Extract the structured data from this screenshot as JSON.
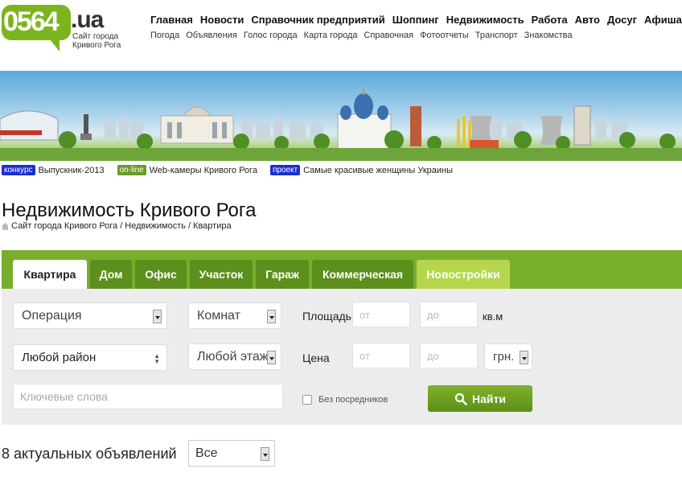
{
  "logo": {
    "number": "0564",
    "domain": ".ua",
    "tagline": "Сайт города Кривого Рога"
  },
  "topnav": [
    "Главная",
    "Новости",
    "Справочник предприятий",
    "Шоппинг",
    "Недвижимость",
    "Работа",
    "Авто",
    "Досуг",
    "Афиша"
  ],
  "subnav": [
    "Погода",
    "Объявления",
    "Голос города",
    "Карта города",
    "Справочная",
    "Фотоотчеты",
    "Транспорт",
    "Знакомства"
  ],
  "promos": [
    {
      "tag": "конкурс",
      "text": "Выпускник-2013"
    },
    {
      "tag": "on-line",
      "text": "Web-камеры Кривого Рога"
    },
    {
      "tag": "проект",
      "text": "Самые красивые женщины Украины"
    }
  ],
  "page": {
    "title": "Недвижимость Кривого Рога"
  },
  "breadcrumb": [
    "Сайт города Кривого Рога",
    "Недвижимость",
    "Квартира"
  ],
  "tabs": [
    "Квартира",
    "Дом",
    "Офис",
    "Участок",
    "Гараж",
    "Коммерческая",
    "Новостройки"
  ],
  "form": {
    "operation": "Операция",
    "rooms": "Комнат",
    "district": "Любой район",
    "floor": "Любой этаж",
    "area_label": "Площадь",
    "price_label": "Цена",
    "from_placeholder": "от",
    "to_placeholder": "до",
    "area_unit": "кв.м",
    "currency": "грн.",
    "keywords_placeholder": "Ключевые слова",
    "no_agents": "Без посредников",
    "find_button": "Найти"
  },
  "results": {
    "count_text": "8 актуальных объявлений",
    "filter": "Все"
  },
  "colors": {
    "brand_green": "#79ae2c",
    "tab_dark": "#5d8f1d",
    "tab_light": "#b5d64c",
    "tag_blue": "#1a2fcc",
    "tag_green": "#6a9a2a"
  }
}
